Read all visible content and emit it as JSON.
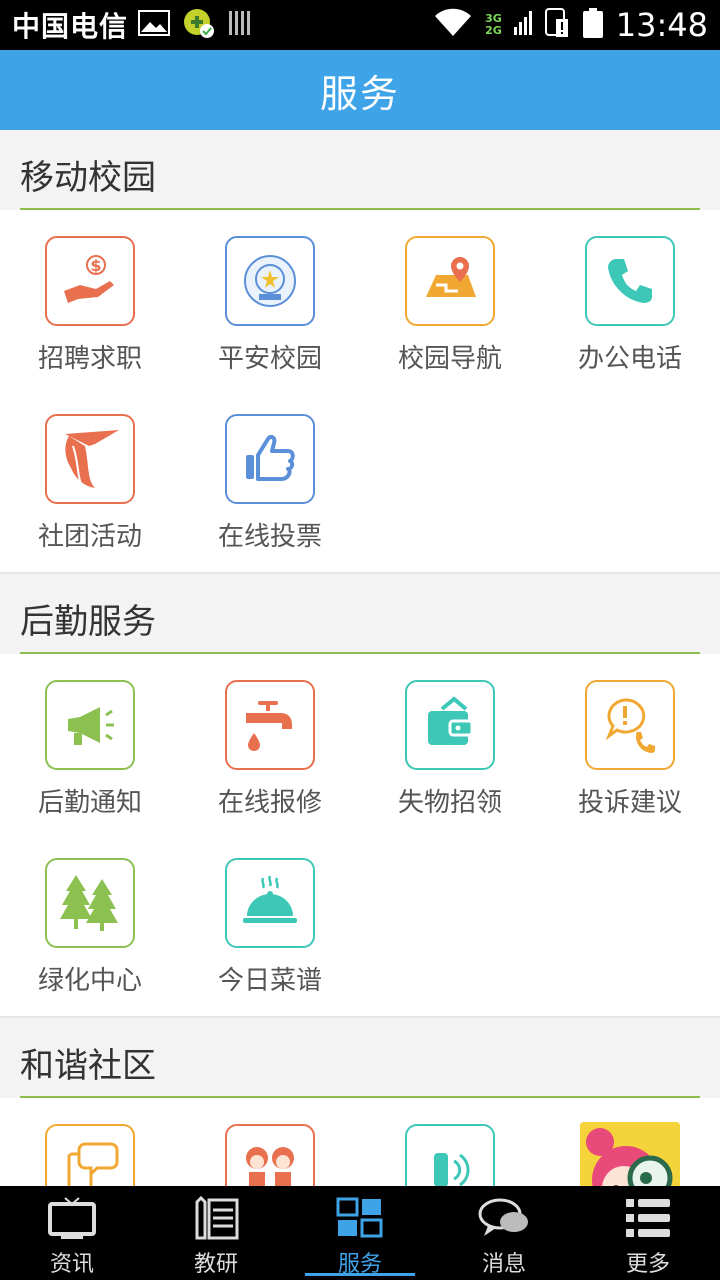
{
  "status_bar": {
    "carrier": "中国电信",
    "network_top": "3G",
    "network_bottom": "2G",
    "time": "13:48"
  },
  "header": {
    "title": "服务"
  },
  "sections": [
    {
      "title": "移动校园",
      "items": [
        {
          "label": "招聘求职",
          "icon": "hand-money-icon",
          "color": "#e8704f"
        },
        {
          "label": "平安校园",
          "icon": "police-badge-icon",
          "color": "#5b8fd9"
        },
        {
          "label": "校园导航",
          "icon": "map-pin-icon",
          "color": "#f0a832"
        },
        {
          "label": "办公电话",
          "icon": "phone-icon",
          "color": "#3cc7b7"
        },
        {
          "label": "社团活动",
          "icon": "flag-scarf-icon",
          "color": "#e8704f"
        },
        {
          "label": "在线投票",
          "icon": "thumbs-up-icon",
          "color": "#5b8fd9"
        }
      ]
    },
    {
      "title": "后勤服务",
      "items": [
        {
          "label": "后勤通知",
          "icon": "megaphone-icon",
          "color": "#8cc152"
        },
        {
          "label": "在线报修",
          "icon": "faucet-icon",
          "color": "#e8704f"
        },
        {
          "label": "失物招领",
          "icon": "wallet-icon",
          "color": "#3cc7b7"
        },
        {
          "label": "投诉建议",
          "icon": "complaint-phone-icon",
          "color": "#f0a832"
        },
        {
          "label": "绿化中心",
          "icon": "trees-icon",
          "color": "#8cc152"
        },
        {
          "label": "今日菜谱",
          "icon": "food-cloche-icon",
          "color": "#3cc7b7"
        }
      ]
    },
    {
      "title": "和谐社区",
      "items": [
        {
          "label": "",
          "icon": "chat-phone-icon",
          "color": "#f0a832"
        },
        {
          "label": "",
          "icon": "couple-icon",
          "color": "#e8704f"
        },
        {
          "label": "",
          "icon": "phone-call-icon",
          "color": "#3cc7b7"
        },
        {
          "label": "",
          "icon": "cartoon-avatar-icon",
          "color": "#e84a7a"
        }
      ]
    }
  ],
  "bottom_nav": [
    {
      "label": "资讯",
      "icon": "tv-icon",
      "active": false
    },
    {
      "label": "教研",
      "icon": "notebook-icon",
      "active": false
    },
    {
      "label": "服务",
      "icon": "grid-icon",
      "active": true
    },
    {
      "label": "消息",
      "icon": "chat-bubble-icon",
      "active": false
    },
    {
      "label": "更多",
      "icon": "list-icon",
      "active": false
    }
  ]
}
